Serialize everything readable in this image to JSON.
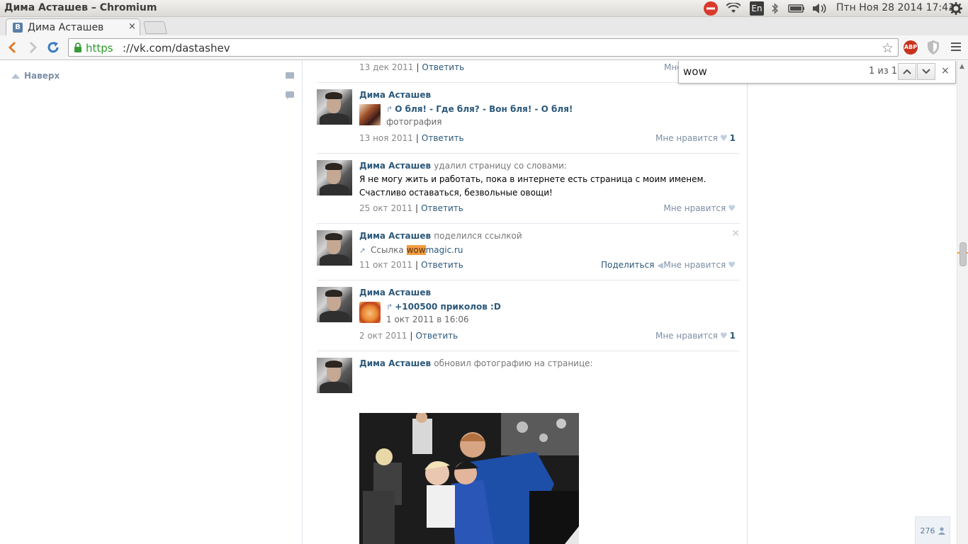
{
  "os_panel": {
    "window_title": "Дима Асташев – Chromium",
    "keyboard_layout": "En",
    "clock": "Птн Ноя 28 2014 17:43",
    "icons": [
      "no-entry-icon",
      "wifi-icon",
      "keyboard-layout-indicator",
      "bluetooth-icon",
      "battery-icon",
      "volume-icon",
      "settings-gear-icon"
    ]
  },
  "browser": {
    "tab": {
      "favicon": "В",
      "title": "Дима Асташев",
      "close": "×"
    },
    "url_scheme": "https",
    "url_rest": "://vk.com/dastashev",
    "abp_label": "ABP"
  },
  "find_bar": {
    "query": "wow",
    "count": "1 из 1",
    "close": "×"
  },
  "left": {
    "back_to_top": "Наверх"
  },
  "wall": {
    "posts": [
      {
        "date": "13 дек 2011",
        "reply": "Ответить",
        "like_label": "Мне"
      },
      {
        "author": "Дима Асташев",
        "repost_title": "О бля! - Где бля? - Вон бля! - О бля!",
        "repost_sub": "фотография",
        "date": "13 ноя 2011",
        "reply": "Ответить",
        "like_label": "Мне нравится",
        "like_count": "1"
      },
      {
        "author": "Дима Асташев",
        "action": "удалил страницу со словами:",
        "text": "Я не могу жить и работать, пока в интернете есть страница с моим именем. Счастливо оставаться, безвольные овощи!",
        "date": "25 окт 2011",
        "reply": "Ответить",
        "like_label": "Мне нравится"
      },
      {
        "author": "Дима Асташев",
        "action": "поделился ссылкой",
        "link_prefix": "Ссылка",
        "link_highlight": "wow",
        "link_rest": "magic.ru",
        "date": "11 окт 2011",
        "reply": "Ответить",
        "share_label": "Поделиться",
        "like_label": "Мне нравится"
      },
      {
        "author": "Дима Асташев",
        "repost_title": "+100500 приколов :D",
        "repost_sub": "1 окт 2011 в 16:06",
        "date": "2 окт 2011",
        "reply": "Ответить",
        "like_label": "Мне нравится",
        "like_count": "1"
      },
      {
        "author": "Дима Асташев",
        "action": "обновил фотографию на странице:"
      }
    ]
  },
  "online_counter": "276",
  "colors": {
    "vk_link": "#2b587a",
    "find_highlight": "#f19d3f",
    "url_green": "#2a9a2a"
  }
}
